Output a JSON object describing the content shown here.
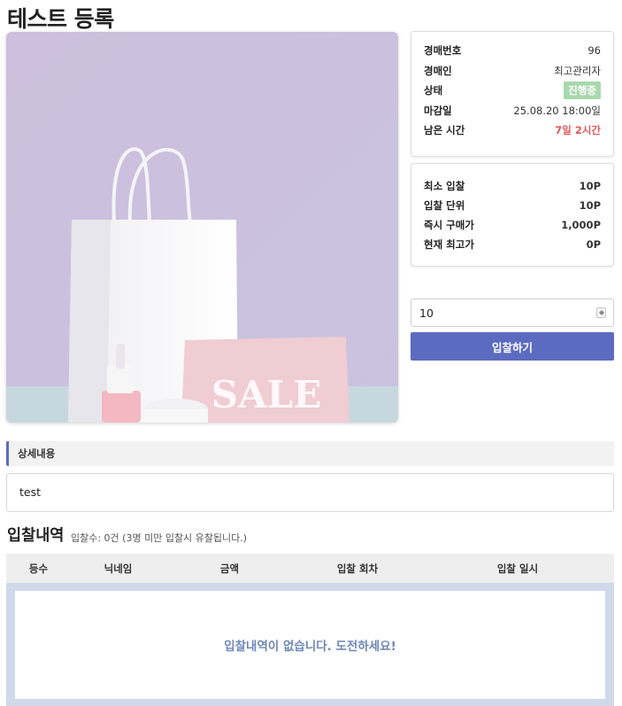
{
  "page": {
    "title": "테스트 등록"
  },
  "product_image": {
    "alt": "shopping bag and SALE card",
    "sale_text": "SALE"
  },
  "auction_info": {
    "rows": [
      {
        "label": "경매번호",
        "value": "96"
      },
      {
        "label": "경매인",
        "value": "최고관리자"
      },
      {
        "label": "상태",
        "value": "진행중"
      },
      {
        "label": "마감일",
        "value": "25.08.20 18:00일"
      },
      {
        "label": "남은 시간",
        "value": "7일 2시간"
      }
    ],
    "status_color": "#a8d8ad",
    "remaining_color": "#e05a5a"
  },
  "bid_info": {
    "rows": [
      {
        "label": "최소 입찰",
        "value": "10P"
      },
      {
        "label": "입찰 단위",
        "value": "10P"
      },
      {
        "label": "즉시 구매가",
        "value": "1,000P"
      },
      {
        "label": "현재 최고가",
        "value": "0P"
      }
    ]
  },
  "bid_form": {
    "amount_value": "10",
    "submit_label": "입찰하기",
    "accent_color": "#5c6bc0"
  },
  "detail": {
    "header": "상세내용",
    "content": "test"
  },
  "bid_history": {
    "title": "입찰내역",
    "subtitle": "입찰수: 0건 (3명 미만 입찰시 유찰됩니다.)",
    "columns": [
      "등수",
      "닉네임",
      "금액",
      "입찰 회차",
      "입찰 일시"
    ],
    "rows": [],
    "empty_message": "입찰내역이 없습니다. 도전하세요!"
  }
}
